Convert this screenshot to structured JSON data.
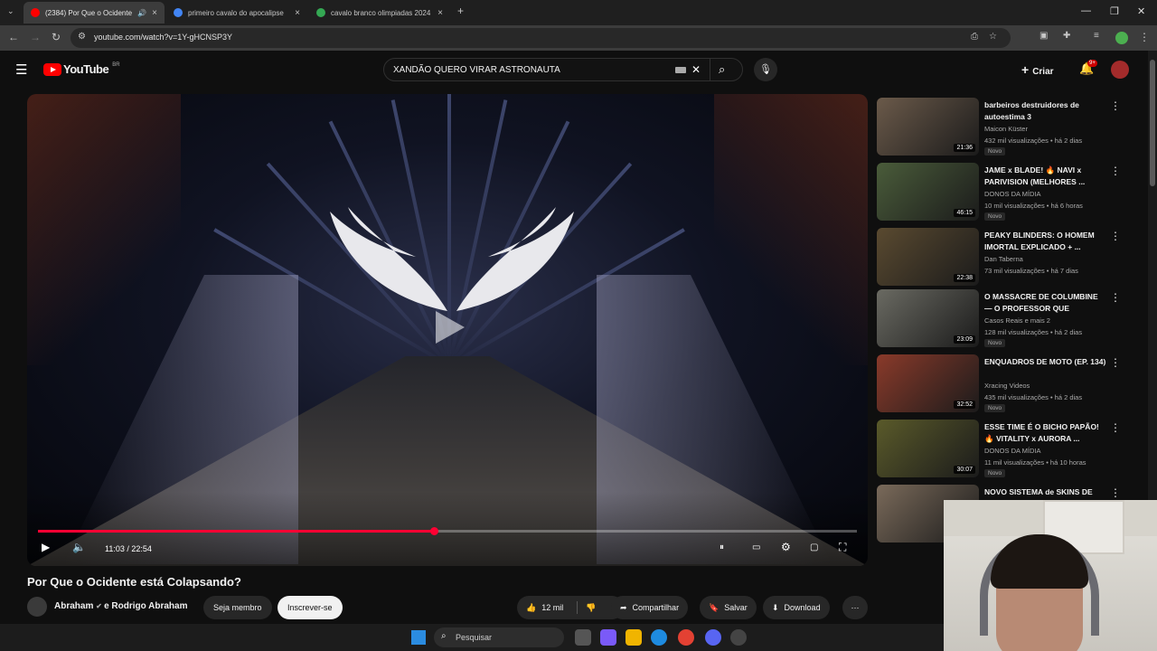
{
  "browser": {
    "tabs": [
      {
        "title": "(2384) Por Que o Ocidente",
        "active": true
      },
      {
        "title": "primeiro cavalo do apocalipse",
        "active": false
      },
      {
        "title": "cavalo branco olimpiadas 2024",
        "active": false
      }
    ],
    "url": "youtube.com/watch?v=1Y-gHCNSP3Y"
  },
  "youtube": {
    "logo_text": "YouTube",
    "region": "BR",
    "search_query": "XANDÃO QUERO VIRAR ASTRONAUTA",
    "create_label": "Criar",
    "notifications": "9+"
  },
  "player": {
    "time": "11:03 / 22:54",
    "progress": 0.4829
  },
  "video": {
    "title": "Por Que o Ocidente está Colapsando?",
    "channel": "Abraham",
    "channel_joiner": "e Rodrigo Abraham",
    "join_label": "Seja membro",
    "subscribe_label": "Inscrever-se",
    "likes": "12 mil",
    "share_label": "Compartilhar",
    "save_label": "Salvar",
    "download_label": "Download"
  },
  "recommendations": [
    {
      "title": "barbeiros destruidores de autoestima 3",
      "channel": "Maicon Küster",
      "meta": "432 mil visualizações • há 2 dias",
      "duration": "21:36",
      "badge": "Novo",
      "color": "#6b5a4a"
    },
    {
      "title": "JAME x BLADE! 🔥 NAVI x PARIVISION (MELHORES ...",
      "channel": "DONOS DA MÍDIA",
      "meta": "10 mil visualizações • há 6 horas",
      "duration": "46:15",
      "badge": "Novo",
      "color": "#4a5c3a"
    },
    {
      "title": "PEAKY BLINDERS: O HOMEM IMORTAL EXPLICADO + ...",
      "channel": "Dan Taberna",
      "meta": "73 mil visualizações • há 7 dias",
      "duration": "22:38",
      "badge": "",
      "color": "#5a4a30"
    },
    {
      "title": "O MASSACRE DE COLUMBINE — O PROFESSOR QUE MORRE...",
      "channel": "Casos Reais e mais 2",
      "meta": "128 mil visualizações • há 2 dias",
      "duration": "23:09",
      "badge": "Novo",
      "color": "#6a6a62"
    },
    {
      "title": "ENQUADROS DE MOTO (EP. 134)",
      "channel": "Xracing Videos",
      "meta": "435 mil visualizações • há 2 dias",
      "duration": "32:52",
      "badge": "Novo",
      "color": "#8a3a2a"
    },
    {
      "title": "ESSE TIME É O BICHO PAPÃO! 🔥 VITALITY x AURORA ...",
      "channel": "DONOS DA MÍDIA",
      "meta": "11 mil visualizações • há 10 horas",
      "duration": "30:07",
      "badge": "Novo",
      "color": "#5a5a2a"
    },
    {
      "title": "NOVO SISTEMA de SKINS DE",
      "channel": "",
      "meta": "",
      "duration": "",
      "badge": "",
      "color": "#7a6a5a"
    }
  ],
  "taskbar": {
    "search_placeholder": "Pesquisar"
  },
  "colors": {
    "accent": "#ff0033",
    "background": "#0f0f0f"
  }
}
